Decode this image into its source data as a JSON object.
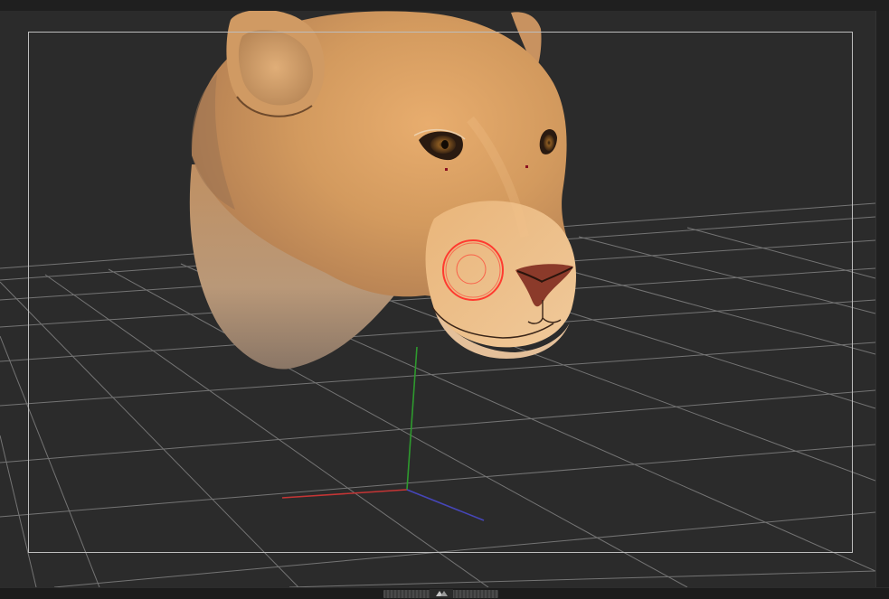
{
  "viewport": {
    "background_color": "#2b2b2b",
    "grid_color": "#9a9a9a",
    "frame_color": "#bcbcbc",
    "axis_colors": {
      "x": "#d23a3a",
      "y": "#2fa82f",
      "z": "#4a4ad0"
    },
    "brush_color": "#ff3b30"
  },
  "model": {
    "fur_color": "#d39a5e",
    "nose_color": "#8b3a2a"
  },
  "icons": {
    "panel_toggle": "up-down-arrows-icon"
  }
}
